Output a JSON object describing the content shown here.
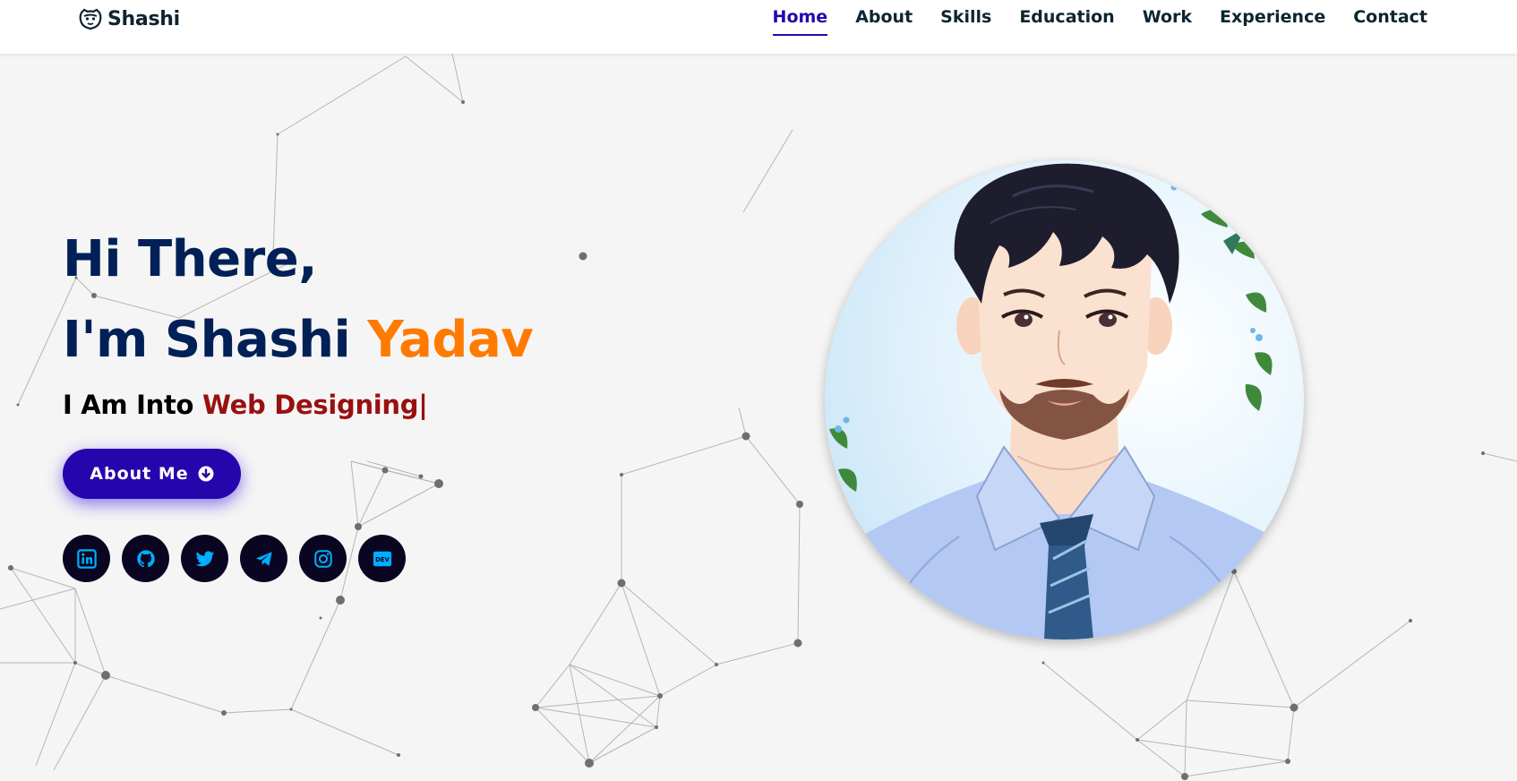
{
  "brand": {
    "name": "Shashi",
    "icon": "napster-cat-icon"
  },
  "nav": {
    "items": [
      {
        "label": "Home",
        "active": true
      },
      {
        "label": "About",
        "active": false
      },
      {
        "label": "Skills",
        "active": false
      },
      {
        "label": "Education",
        "active": false
      },
      {
        "label": "Work",
        "active": false
      },
      {
        "label": "Experience",
        "active": false
      },
      {
        "label": "Contact",
        "active": false
      }
    ]
  },
  "hero": {
    "greeting": "Hi There,",
    "intro": "I'm Shashi ",
    "surname": "Yadav",
    "typing_prefix": "I Am Into ",
    "typing_text": "Web Designing",
    "cursor": "|",
    "button_label": "About Me",
    "button_icon": "arrow-circle-down-icon"
  },
  "socials": [
    {
      "name": "linkedin-icon"
    },
    {
      "name": "github-icon"
    },
    {
      "name": "twitter-icon"
    },
    {
      "name": "telegram-icon"
    },
    {
      "name": "instagram-icon"
    },
    {
      "name": "dev-icon",
      "label": "DEV"
    }
  ],
  "colors": {
    "accent": "#2506ad",
    "heading": "#002057",
    "surname": "#ff7a00",
    "typed": "#991010",
    "social_bg": "#0a0621",
    "social_icon": "#00aeff",
    "background": "#f5f5f5"
  },
  "avatar": {
    "alt": "Profile illustration"
  }
}
